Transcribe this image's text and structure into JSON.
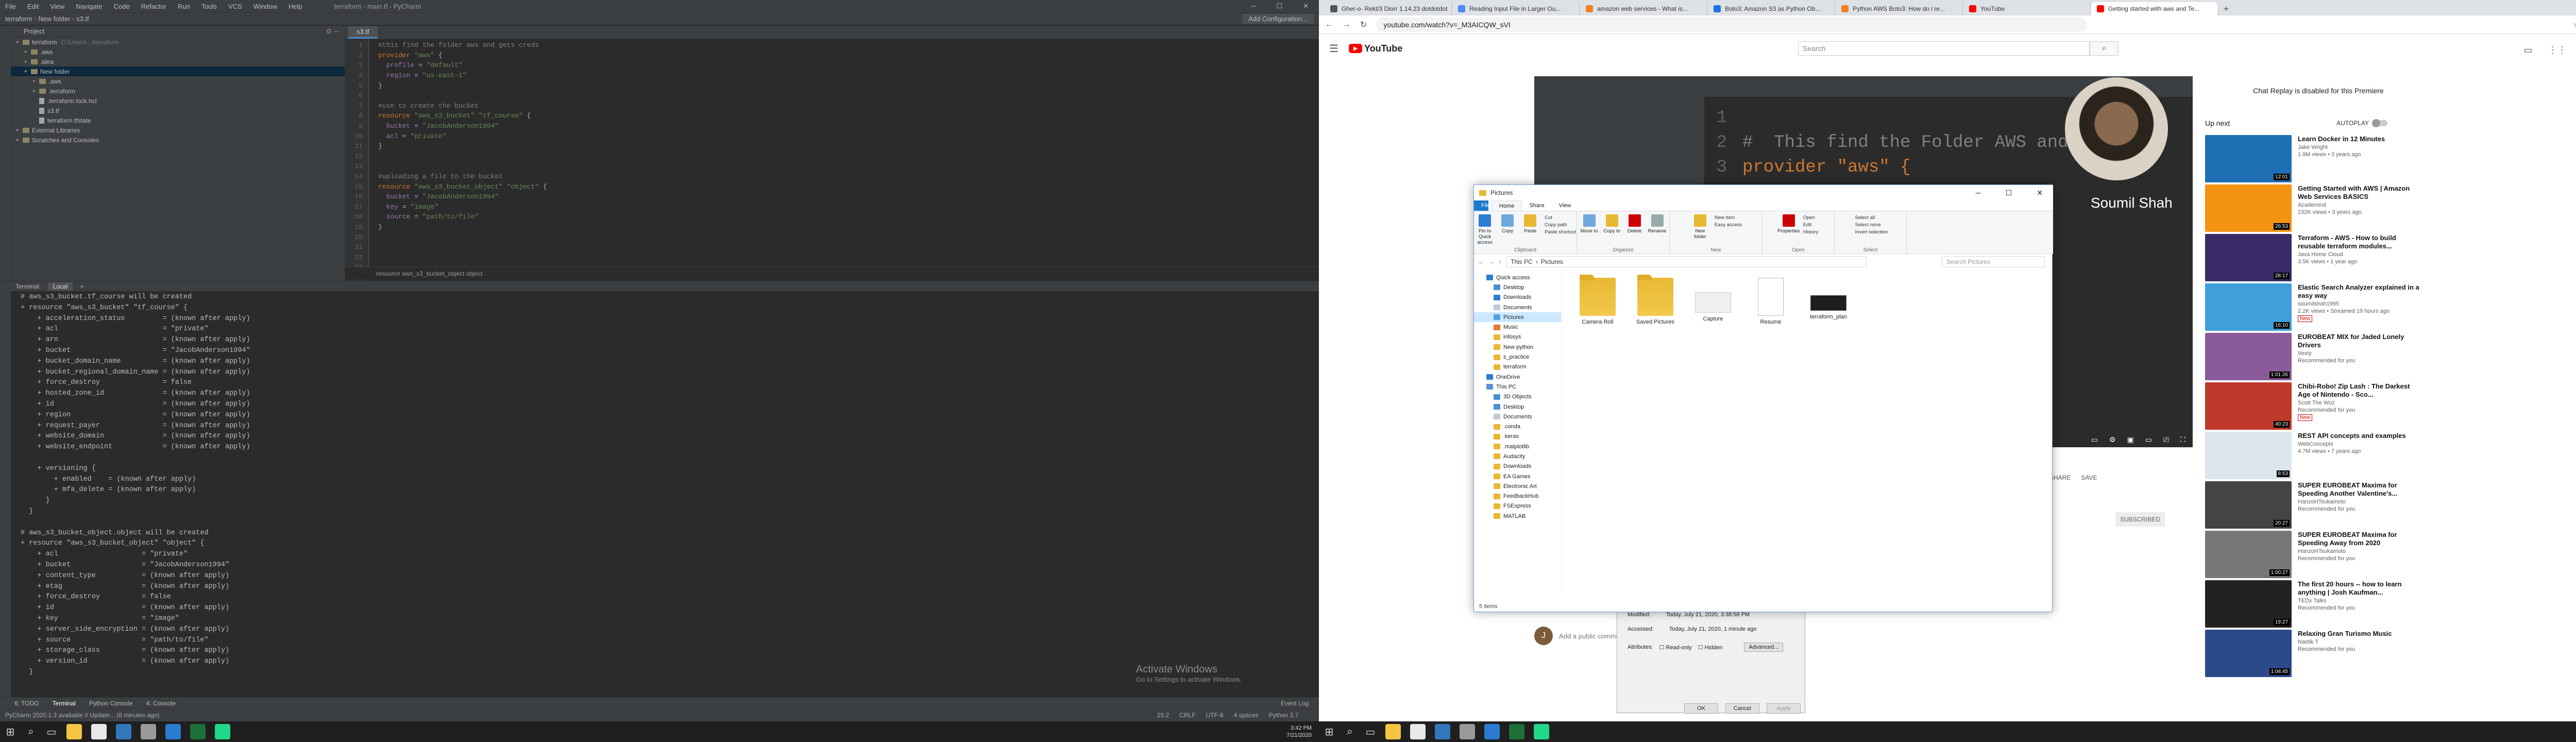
{
  "ide": {
    "title_menu": [
      "File",
      "Edit",
      "View",
      "Navigate",
      "Code",
      "Refactor",
      "Run",
      "Tools",
      "VCS",
      "Window",
      "Help"
    ],
    "title_path": "terraform - main.tf - PyCharm",
    "nav_crumbs": [
      "terraform",
      "New folder",
      "s3.tf"
    ],
    "run_config": "Add Configuration...",
    "project_label": "Project",
    "tree": [
      {
        "depth": 0,
        "label": "terraform",
        "note": "C:\\Users\\...\\terraform",
        "kind": "folder",
        "selected": false
      },
      {
        "depth": 1,
        "label": ".aws",
        "kind": "folder",
        "selected": false
      },
      {
        "depth": 1,
        "label": ".idea",
        "kind": "folder",
        "selected": false
      },
      {
        "depth": 1,
        "label": "New folder",
        "kind": "folder",
        "selected": true
      },
      {
        "depth": 2,
        "label": ".aws",
        "kind": "folder",
        "selected": false
      },
      {
        "depth": 2,
        "label": ".terraform",
        "kind": "folder",
        "selected": false
      },
      {
        "depth": 2,
        "label": ".terraform.lock.hcl",
        "kind": "file",
        "selected": false
      },
      {
        "depth": 2,
        "label": "s3.tf",
        "kind": "file",
        "selected": false
      },
      {
        "depth": 2,
        "label": "terraform.tfstate",
        "kind": "file",
        "selected": false
      },
      {
        "depth": 0,
        "label": "External Libraries",
        "kind": "folder",
        "selected": false
      },
      {
        "depth": 0,
        "label": "Scratches and Consoles",
        "kind": "folder",
        "selected": false
      }
    ],
    "editor_tab": "s3.tf",
    "code_lines": [
      [
        [
          "cm",
          "#this find the folder aws and gets creds"
        ]
      ],
      [
        [
          "kw",
          "provider "
        ],
        [
          "st",
          "\"aws\""
        ],
        [
          "",
          " {"
        ]
      ],
      [
        [
          "ky",
          "  profile "
        ],
        [
          "",
          "= "
        ],
        [
          "st",
          "\"default\""
        ]
      ],
      [
        [
          "ky",
          "  region "
        ],
        [
          "",
          "= "
        ],
        [
          "st",
          "\"us-east-1\""
        ]
      ],
      [
        [
          "",
          "}"
        ]
      ],
      [
        [
          "",
          ""
        ]
      ],
      [
        [
          "cm",
          "#use to create the bucket"
        ]
      ],
      [
        [
          "kw",
          "resource "
        ],
        [
          "st",
          "\"aws_s3_bucket\" \"tf_course\""
        ],
        [
          "",
          " {"
        ]
      ],
      [
        [
          "ky",
          "  bucket "
        ],
        [
          "",
          "= "
        ],
        [
          "st",
          "\"JacobAnderson1994\""
        ]
      ],
      [
        [
          "ky",
          "  acl "
        ],
        [
          "",
          "= "
        ],
        [
          "st",
          "\"private\""
        ]
      ],
      [
        [
          "",
          "}"
        ]
      ],
      [
        [
          "",
          ""
        ]
      ],
      [
        [
          "",
          ""
        ]
      ],
      [
        [
          "cm",
          "#uploading a file to the bucket"
        ]
      ],
      [
        [
          "kw",
          "resource "
        ],
        [
          "st",
          "\"aws_s3_bucket_object\" \"object\""
        ],
        [
          "",
          " {"
        ]
      ],
      [
        [
          "ky",
          "  bucket "
        ],
        [
          "",
          "= "
        ],
        [
          "st",
          "\"JacobAnderson1994\""
        ]
      ],
      [
        [
          "ky",
          "  key "
        ],
        [
          "",
          "= "
        ],
        [
          "st",
          "\"image\""
        ]
      ],
      [
        [
          "ky",
          "  source "
        ],
        [
          "",
          "= "
        ],
        [
          "st",
          "\"path/to/file\""
        ]
      ],
      [
        [
          "",
          "}"
        ]
      ],
      [
        [
          "",
          ""
        ]
      ],
      [
        [
          "",
          ""
        ]
      ],
      [
        [
          "",
          ""
        ]
      ],
      [
        [
          "",
          ""
        ]
      ]
    ],
    "editor_crumb": "resource aws_s3_bucket_object object",
    "terminal_tabs": [
      "Terminal:",
      "Local",
      "+"
    ],
    "terminal_lines": [
      "# aws_s3_bucket.tf_course will be created",
      "+ resource \"aws_s3_bucket\" \"tf_course\" {",
      "    + acceleration_status         = (known after apply)",
      "    + acl                         = \"private\"",
      "    + arn                         = (known after apply)",
      "    + bucket                      = \"JacobAnderson1994\"",
      "    + bucket_domain_name          = (known after apply)",
      "    + bucket_regional_domain_name = (known after apply)",
      "    + force_destroy               = false",
      "    + hosted_zone_id              = (known after apply)",
      "    + id                          = (known after apply)",
      "    + region                      = (known after apply)",
      "    + request_payer               = (known after apply)",
      "    + website_domain              = (known after apply)",
      "    + website_endpoint            = (known after apply)",
      "",
      "    + versioning {",
      "        + enabled    = (known after apply)",
      "        + mfa_delete = (known after apply)",
      "      }",
      "  }",
      "",
      "# aws_s3_bucket_object.object will be created",
      "+ resource \"aws_s3_bucket_object\" \"object\" {",
      "    + acl                    = \"private\"",
      "    + bucket                 = \"JacobAnderson1994\"",
      "    + content_type           = (known after apply)",
      "    + etag                   = (known after apply)",
      "    + force_destroy          = false",
      "    + id                     = (known after apply)",
      "    + key                    = \"image\"",
      "    + server_side_encryption = (known after apply)",
      "    + source                 = \"path/to/file\"",
      "    + storage_class          = (known after apply)",
      "    + version_id             = (known after apply)",
      "  }"
    ],
    "activate_title": "Activate Windows",
    "activate_sub": "Go to Settings to activate Windows.",
    "tool_tabs": [
      "6: TODO",
      "Terminal",
      "Python Console",
      "4: Console"
    ],
    "event_log": "Event Log",
    "status_left": "PyCharm 2020.1.3 available // Update... (8 minutes ago)",
    "status_right": [
      "25:2",
      "CRLF",
      "UTF-8",
      "4 spaces",
      "Python 3.7"
    ]
  },
  "taskbar": {
    "time": "3:42 PM",
    "date": "7/21/2020"
  },
  "browser": {
    "tabs": [
      {
        "label": "Gher-o- Rekt/3 Diorr 1.14.23 dotdotdot",
        "color": "#555",
        "active": false
      },
      {
        "label": "Reading Input File in Larger Ou...",
        "color": "#4c8bf5",
        "active": false
      },
      {
        "label": "amazon web services - What is...",
        "color": "#f48024",
        "active": false
      },
      {
        "label": "Boto3: Amazon S3 as Python Ob...",
        "color": "#1a73e8",
        "active": false
      },
      {
        "label": "Python AWS Boto3: How do i re...",
        "color": "#f48024",
        "active": false
      },
      {
        "label": "YouTube",
        "color": "#ff0000",
        "active": false
      },
      {
        "label": "Getting started with aws and Te...",
        "color": "#ff0000",
        "active": true
      }
    ],
    "url": "youtube.com/watch?v=_M3AICQW_sVI",
    "yt": {
      "logo": "YouTube",
      "search_placeholder": "Search",
      "avatar": "J",
      "video_code": [
        "#  This find the Folder AWS and gets",
        "provider \"aws\" {"
      ],
      "video_line_nums": [
        "1",
        "2",
        "3"
      ],
      "presenter": "Soumil Shah",
      "chat_replay": "Chat Replay is disabled for this Premiere",
      "up_next": "Up next",
      "autoplay": "AUTOPLAY",
      "actions": [
        "SHARE",
        "SAVE"
      ],
      "subscribed": "SUBSCRIBED",
      "comment_avatar": "J",
      "comment_placeholder": "Add a public comment...",
      "recs": [
        {
          "title": "Learn Docker in 12 Minutes",
          "channel": "Jake Wright",
          "meta": "1.9M views • 3 years ago",
          "dur": "12:01",
          "color": "#1f6fb5",
          "badge": ""
        },
        {
          "title": "Getting Started with AWS | Amazon Web Services BASICS",
          "channel": "Academind",
          "meta": "232K views • 3 years ago",
          "dur": "26:53",
          "color": "#f29312",
          "badge": ""
        },
        {
          "title": "Terraform - AWS - How to build reusable terraform modules...",
          "channel": "Java Home Cloud",
          "meta": "3.5K views • 1 year ago",
          "dur": "28:17",
          "color": "#3a2b6a",
          "badge": ""
        },
        {
          "title": "Elastic Search Analyzer explained in a easy way",
          "channel": "soumilshah1995",
          "meta": "2.2K views • Streamed 19 hours ago",
          "dur": "16:10",
          "color": "#3fa0d9",
          "badge": "New"
        },
        {
          "title": "EUROBEAT MIX for Jaded Lonely Drivers",
          "channel": "Vesty",
          "meta": "Recommended for you",
          "dur": "1:01:26",
          "color": "#8a5a9a",
          "badge": ""
        },
        {
          "title": "Chibi-Robo! Zip Lash : The Darkest Age of Nintendo - Sco...",
          "channel": "Scott The Woz",
          "meta": "Recommended for you",
          "dur": "40:23",
          "color": "#c0392b",
          "badge": "New"
        },
        {
          "title": "REST API concepts and examples",
          "channel": "WebConcepts",
          "meta": "4.7M views • 7 years ago",
          "dur": "8:53",
          "color": "#dbe6ee",
          "badge": ""
        },
        {
          "title": "SUPER EUROBEAT Maxima for Speeding Another Valentine's...",
          "channel": "HanzoHTsukamoto",
          "meta": "Recommended for you",
          "dur": "20:27",
          "color": "#444",
          "badge": ""
        },
        {
          "title": "SUPER EUROBEAT Maxima for Speeding Away from 2020",
          "channel": "HanzoHTsukamoto",
          "meta": "Recommended for you",
          "dur": "1:00:27",
          "color": "#777",
          "badge": ""
        },
        {
          "title": "The first 20 hours -- how to learn anything | Josh Kaufman...",
          "channel": "TEDx Talks",
          "meta": "Recommended for you",
          "dur": "19:27",
          "color": "#222",
          "badge": ""
        },
        {
          "title": "Relaxing Gran Turismo Music",
          "channel": "Nastik T",
          "meta": "Recommended for you",
          "dur": "1:04:45",
          "color": "#2c4a8a",
          "badge": ""
        }
      ]
    }
  },
  "properties": {
    "modified_label": "Modified:",
    "modified_val": "Today, July 21, 2020, 3:38:58 PM",
    "accessed_label": "Accessed:",
    "accessed_val": "Today, July 21, 2020, 1 minute ago",
    "attributes_label": "Attributes:",
    "readonly": "Read-only",
    "hidden": "Hidden",
    "advanced": "Advanced...",
    "ok": "OK",
    "cancel": "Cancel",
    "apply": "Apply"
  },
  "explorer": {
    "title": "Pictures",
    "ribbon_tabs": [
      "File",
      "Home",
      "Share",
      "View"
    ],
    "groups": [
      {
        "name": "Clipboard",
        "items": [
          "Pin to Quick access",
          "Copy",
          "Paste"
        ],
        "small": [
          "Cut",
          "Copy path",
          "Paste shortcut"
        ]
      },
      {
        "name": "Organize",
        "items": [
          "Move to",
          "Copy to",
          "Delete",
          "Rename"
        ],
        "small": []
      },
      {
        "name": "New",
        "items": [
          "New folder"
        ],
        "small": [
          "New item",
          "Easy access"
        ]
      },
      {
        "name": "Open",
        "items": [
          "Properties"
        ],
        "small": [
          "Open",
          "Edit",
          "History"
        ]
      },
      {
        "name": "Select",
        "items": [],
        "small": [
          "Select all",
          "Select none",
          "Invert selection"
        ]
      }
    ],
    "address": [
      "This PC",
      "Pictures"
    ],
    "search_placeholder": "Search Pictures",
    "nav": [
      {
        "label": "Quick access",
        "kind": "star",
        "indent": false,
        "sel": false
      },
      {
        "label": "Desktop",
        "kind": "blue",
        "indent": true,
        "sel": false
      },
      {
        "label": "Downloads",
        "kind": "down",
        "indent": true,
        "sel": false
      },
      {
        "label": "Documents",
        "kind": "doc",
        "indent": true,
        "sel": false
      },
      {
        "label": "Pictures",
        "kind": "pic",
        "indent": true,
        "sel": true
      },
      {
        "label": "Music",
        "kind": "music",
        "indent": true,
        "sel": false
      },
      {
        "label": "infosys",
        "kind": "fold",
        "indent": true,
        "sel": false
      },
      {
        "label": "New python",
        "kind": "fold",
        "indent": true,
        "sel": false
      },
      {
        "label": "s_practice",
        "kind": "fold",
        "indent": true,
        "sel": false
      },
      {
        "label": "terraform",
        "kind": "fold",
        "indent": true,
        "sel": false
      },
      {
        "label": "OneDrive",
        "kind": "cloud",
        "indent": false,
        "sel": false
      },
      {
        "label": "This PC",
        "kind": "pc",
        "indent": false,
        "sel": false
      },
      {
        "label": "3D Objects",
        "kind": "blue",
        "indent": true,
        "sel": false
      },
      {
        "label": "Desktop",
        "kind": "blue",
        "indent": true,
        "sel": false
      },
      {
        "label": "Documents",
        "kind": "doc",
        "indent": true,
        "sel": false
      },
      {
        "label": ".conda",
        "kind": "fold",
        "indent": true,
        "sel": false
      },
      {
        "label": ".keras",
        "kind": "fold",
        "indent": true,
        "sel": false
      },
      {
        "label": ".matplotlib",
        "kind": "fold",
        "indent": true,
        "sel": false
      },
      {
        "label": "Audacity",
        "kind": "fold",
        "indent": true,
        "sel": false
      },
      {
        "label": "Downloads",
        "kind": "fold",
        "indent": true,
        "sel": false
      },
      {
        "label": "EA Games",
        "kind": "fold",
        "indent": true,
        "sel": false
      },
      {
        "label": "Electronic Art",
        "kind": "fold",
        "indent": true,
        "sel": false
      },
      {
        "label": "FeedbackHub",
        "kind": "fold",
        "indent": true,
        "sel": false
      },
      {
        "label": "FSExpress",
        "kind": "fold",
        "indent": true,
        "sel": false
      },
      {
        "label": "MATLAB",
        "kind": "fold",
        "indent": true,
        "sel": false
      }
    ],
    "files": [
      {
        "label": "Camera Roll",
        "kind": "folder"
      },
      {
        "label": "Saved Pictures",
        "kind": "folder"
      },
      {
        "label": "Capture",
        "kind": "image"
      },
      {
        "label": "Resume",
        "kind": "doc"
      },
      {
        "label": "terraform_plan",
        "kind": "image2"
      }
    ],
    "status": "5 items"
  }
}
